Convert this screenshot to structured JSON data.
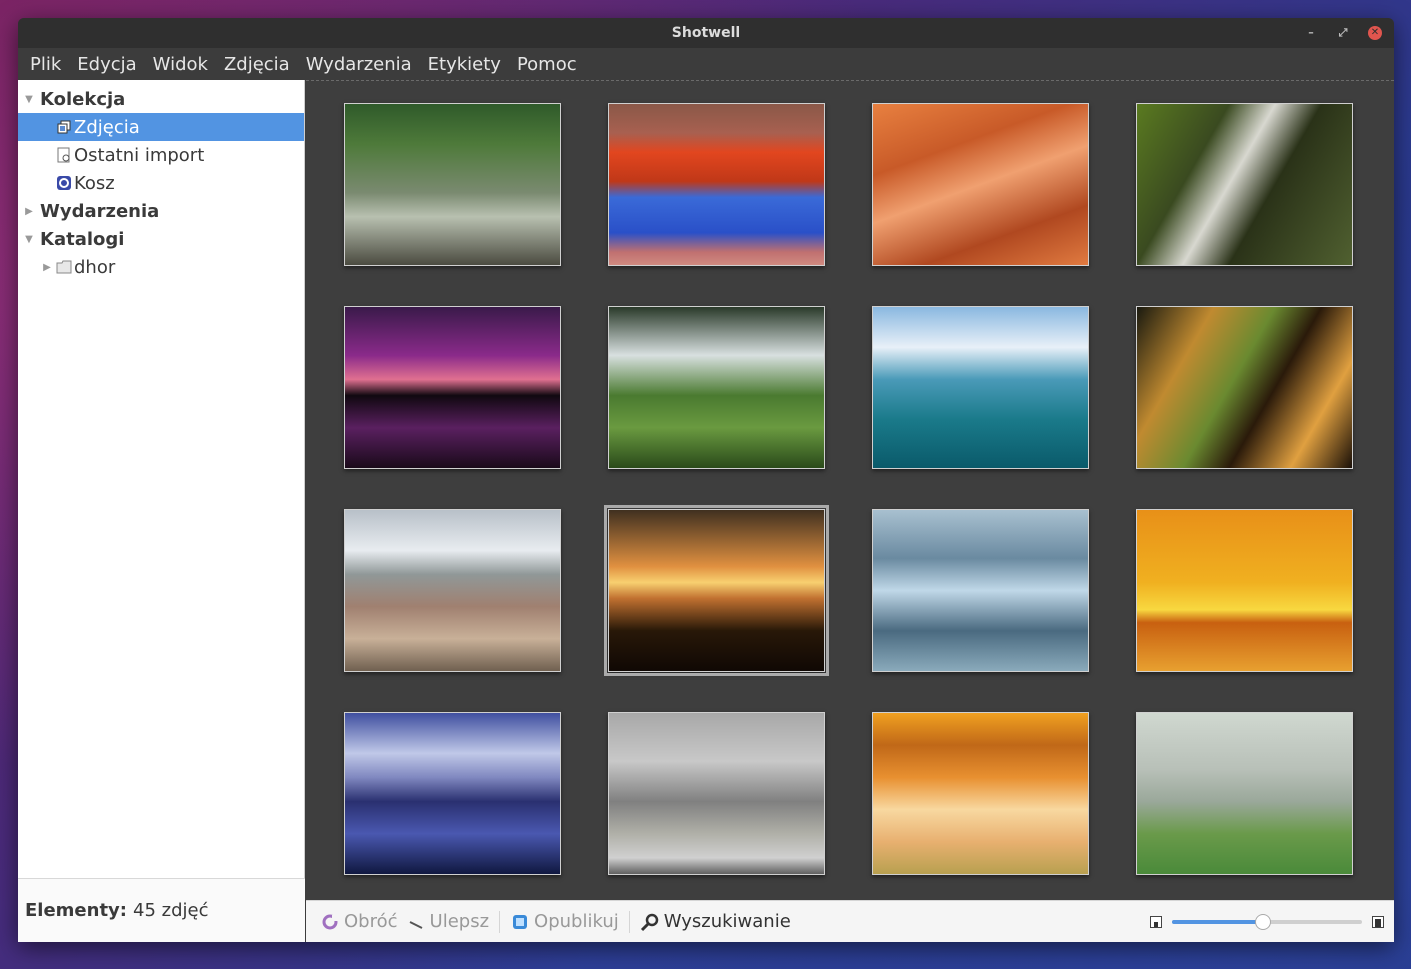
{
  "window": {
    "title": "Shotwell"
  },
  "menu": [
    "Plik",
    "Edycja",
    "Widok",
    "Zdjęcia",
    "Wydarzenia",
    "Etykiety",
    "Pomoc"
  ],
  "sidebar": {
    "collection_header": "Kolekcja",
    "collection_items": [
      {
        "label": "Zdjęcia",
        "icon": "photos-icon",
        "selected": true
      },
      {
        "label": "Ostatni import",
        "icon": "import-icon",
        "selected": false
      },
      {
        "label": "Kosz",
        "icon": "trash-icon",
        "selected": false
      }
    ],
    "events_header": "Wydarzenia",
    "folders_header": "Katalogi",
    "folders": [
      {
        "label": "dhor",
        "icon": "folder-icon"
      }
    ]
  },
  "status": {
    "label": "Elementy:",
    "value": "45 zdjęć"
  },
  "toolbar": {
    "rotate": "Obróć",
    "enhance": "Ulepsz",
    "publish": "Opublikuj",
    "search": "Wyszukiwanie",
    "zoom_level": 0.48
  },
  "photos": [
    {
      "name": "forest-stream",
      "selected": false,
      "bg": "linear-gradient(180deg,#2f5a2a 0%,#4e7a3a 25%,#7a8a70 55%,#b8c0b0 70%,#4b4b40 100%)"
    },
    {
      "name": "red-rock-reflection",
      "selected": false,
      "bg": "linear-gradient(180deg,#8a5848 0%,#a86050 18%,#e2461f 30%,#c03818 48%,#3a6ad8 58%,#2a50c8 80%,#c07070 92%,#d08a80 100%)"
    },
    {
      "name": "orange-canyon",
      "selected": false,
      "bg": "linear-gradient(160deg,#e88040 0%,#c85a28 30%,#f0a070 50%,#b04820 75%,#e07a40 100%)"
    },
    {
      "name": "waterfall-cliff",
      "selected": false,
      "bg": "linear-gradient(120deg,#5a7a20 0%,#3a4a20 30%,#d8d8d0 45%,#2a3218 60%,#506030 100%)"
    },
    {
      "name": "purple-sunset-lake",
      "selected": false,
      "bg": "linear-gradient(180deg,#3a1a4a 0%,#8a2a8a 30%,#e07090 45%,#100810 55%,#5a2060 75%,#1a0a1a 100%)"
    },
    {
      "name": "waterfall-ferns",
      "selected": false,
      "bg": "linear-gradient(180deg,#2a3a2a 0%,#d8e0e0 30%,#4a7a30 55%,#6a9a40 75%,#2a4a1a 100%)"
    },
    {
      "name": "ocean-wave",
      "selected": false,
      "bg": "linear-gradient(180deg,#8ab8e0 0%,#e8f0f8 25%,#4a9ab8 45%,#1a7a8a 70%,#0a5a6a 100%)"
    },
    {
      "name": "cave-formations",
      "selected": false,
      "bg": "linear-gradient(120deg,#1a1a10 0%,#c08a30 25%,#6a8a30 45%,#2a1a0a 60%,#e0a040 80%,#1a1008 100%)"
    },
    {
      "name": "rocky-beach",
      "selected": false,
      "bg": "linear-gradient(180deg,#b8c0c8 0%,#e8ecf0 25%,#909898 40%,#a08070 60%,#c8b098 80%,#706050 100%)"
    },
    {
      "name": "sea-stack-sunset",
      "selected": true,
      "bg": "linear-gradient(180deg,#403020 0%,#e09040 35%,#f8d070 45%,#c07030 55%,#281808 75%,#100804 100%)"
    },
    {
      "name": "misty-forest",
      "selected": false,
      "bg": "linear-gradient(180deg,#a8c0d0 0%,#6a8aa0 30%,#c0d8e8 50%,#4a6a80 75%,#8aaabb 100%)"
    },
    {
      "name": "birds-sunset",
      "selected": false,
      "bg": "linear-gradient(180deg,#e89018 0%,#f0b020 45%,#f8d840 62%,#c86010 70%,#e8a030 100%)"
    },
    {
      "name": "blue-pier-lake",
      "selected": false,
      "bg": "linear-gradient(180deg,#4050a0 0%,#c0c8e8 25%,#8088c0 40%,#2a3070 55%,#4a58b0 75%,#101840 100%)"
    },
    {
      "name": "foggy-valley",
      "selected": false,
      "bg": "linear-gradient(180deg,#a8a8a8 0%,#c8c8c8 30%,#808080 55%,#b0b0a8 75%,#d0d0d0 90%,#606060 100%)"
    },
    {
      "name": "golden-mist-hills",
      "selected": false,
      "bg": "linear-gradient(180deg,#f0a020 0%,#c06818 20%,#e89030 40%,#f8d8a0 60%,#e8b070 80%,#b8a050 100%)"
    },
    {
      "name": "foggy-tree-lane",
      "selected": false,
      "bg": "linear-gradient(180deg,#d0d8d0 0%,#b8c0b8 35%,#9aa89a 55%,#6a9a4a 75%,#4a8a3a 100%)"
    }
  ]
}
